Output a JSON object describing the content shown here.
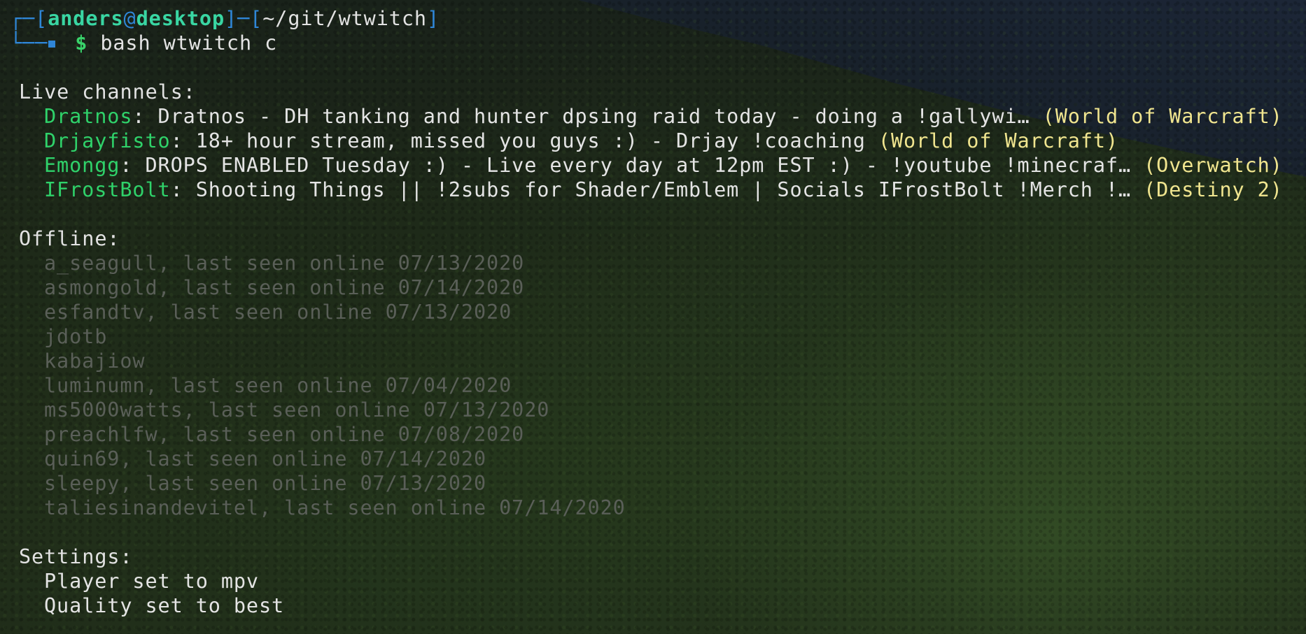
{
  "prompt": {
    "user": "anders",
    "at": "@",
    "host": "desktop",
    "path": "~/git/wtwitch",
    "symbol": "$",
    "command": "bash wtwitch c"
  },
  "live": {
    "heading": "Live channels:",
    "channels": [
      {
        "name": "Dratnos",
        "title": "Dratnos - DH tanking and hunter dpsing raid today - doing a !gallywi…",
        "game": "(World of Warcraft)"
      },
      {
        "name": "Drjayfisto",
        "title": "18+ hour stream, missed you guys :) - Drjay !coaching",
        "game": "(World of Warcraft)"
      },
      {
        "name": "Emongg",
        "title": "DROPS ENABLED Tuesday :) - Live every day at 12pm EST :) - !youtube !minecraf…",
        "game": "(Overwatch)"
      },
      {
        "name": "IFrostBolt",
        "title": "Shooting Things || !2subs for Shader/Emblem | Socials IFrostBolt !Merch !…",
        "game": "(Destiny 2)"
      }
    ]
  },
  "offline": {
    "heading": "Offline:",
    "channels": [
      "a_seagull, last seen online 07/13/2020",
      "asmongold, last seen online 07/14/2020",
      "esfandtv, last seen online 07/13/2020",
      "jdotb",
      "kabajiow",
      "luminumn, last seen online 07/04/2020",
      "ms5000watts, last seen online 07/13/2020",
      "preachlfw, last seen online 07/08/2020",
      "quin69, last seen online 07/14/2020",
      "sleepy, last seen online 07/13/2020",
      "taliesinandevitel, last seen online 07/14/2020"
    ]
  },
  "settings": {
    "heading": "Settings:",
    "items": [
      "Player set to mpv",
      "Quality set to best"
    ]
  },
  "colors": {
    "live_name": "#2fd26a",
    "game": "#f0e58f",
    "offline": "#5a5f58",
    "prompt_frame": "#2f86d7",
    "user_host": "#39d6a3"
  }
}
